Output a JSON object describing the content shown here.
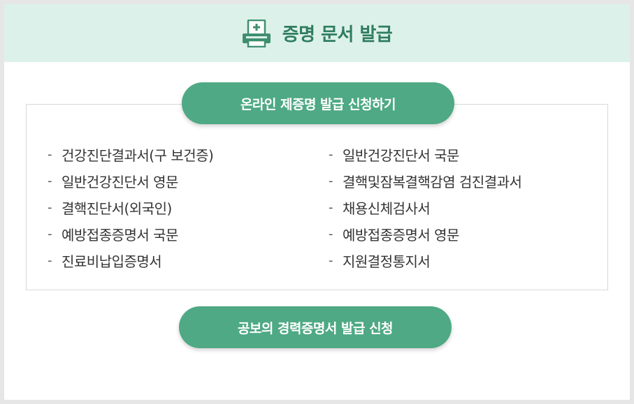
{
  "header": {
    "icon": "printer-document-icon",
    "title": "증명 문서 발급"
  },
  "online_button": {
    "label": "온라인 제증명 발급 신청하기"
  },
  "documents": {
    "left": [
      {
        "label": "건강진단결과서(구 보건증)"
      },
      {
        "label": "일반건강진단서 영문"
      },
      {
        "label": "결핵진단서(외국인)"
      },
      {
        "label": "예방접종증명서 국문"
      },
      {
        "label": "진료비납입증명서"
      }
    ],
    "right": [
      {
        "label": "일반건강진단서 국문"
      },
      {
        "label": "결핵및잠복결핵감염 검진결과서"
      },
      {
        "label": "채용신체검사서"
      },
      {
        "label": "예방접종증명서 영문"
      },
      {
        "label": "지원결정통지서"
      }
    ]
  },
  "career_button": {
    "label": "공보의 경력증명서 발급 신청"
  },
  "colors": {
    "header_bg": "#ddf1eb",
    "accent": "#4ea984",
    "title": "#2f7d5f"
  }
}
